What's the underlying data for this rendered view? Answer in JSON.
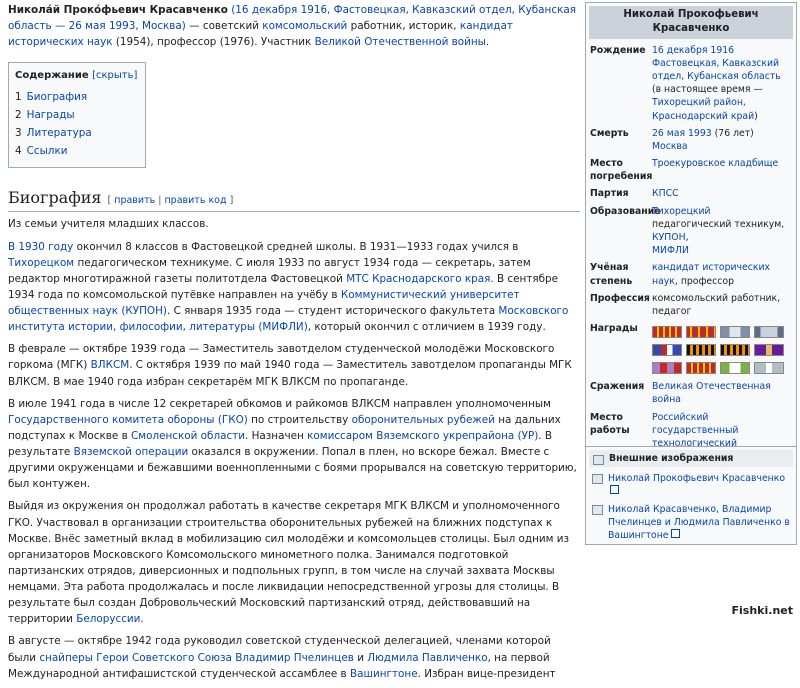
{
  "intro": {
    "name": "Никола́й Проко́фьевич Красавченко",
    "dates_link": "(16 декабря 1916, Фастовецкая, Кавказский отдел, Кубанская область — 26 мая 1993, Москва)",
    "t1": " — советский ",
    "l1": "комсомольский",
    "t2": " работник, историк, ",
    "l2": "кандидат исторических наук",
    "t3": " (1954), профессор (1976). Участник ",
    "l3": "Великой Отечественной войны",
    "t4": "."
  },
  "toc": {
    "title": "Содержание",
    "hide": "[скрыть]",
    "items": [
      {
        "num": "1",
        "label": "Биография"
      },
      {
        "num": "2",
        "label": "Награды"
      },
      {
        "num": "3",
        "label": "Литература"
      },
      {
        "num": "4",
        "label": "Ссылки"
      }
    ]
  },
  "section": {
    "heading": "Биография",
    "edit_open": "[ ",
    "edit": "править",
    "edit_sep": " | ",
    "edit_code": "править код",
    "edit_close": " ]"
  },
  "p1": {
    "t1": "Из семьи учителя младших классов."
  },
  "p2": {
    "l1": "В 1930 году",
    "t1": " окончил 8 классов в Фастовецкой средней школы. В 1931—1933 годах учился в ",
    "l2": "Тихорецком",
    "t2": " педагогическом техникуме. С июля 1933 по август 1934 года — секретарь, затем редактор многотиражной газеты политотдела Фастовецкой ",
    "l3": "МТС",
    "t3": " ",
    "l4": "Краснодарского края",
    "t4": ". В сентябре 1934 года по комсомольской путёвке направлен на учёбу в ",
    "l5": "Коммунистический университет общественных наук (КУПОН)",
    "t5": ". С января 1935 года — студент исторического факультета ",
    "l6": "Московского института истории, философии, литературы (МИФЛИ)",
    "t6": ", который окончил с отличием в 1939 году."
  },
  "p3": {
    "t1": "В феврале — октябре 1939 года — Заместитель завотделом студенческой молодёжи Московского горкома (МГК) ",
    "l1": "ВЛКСМ",
    "t2": ". С октября 1939 по май 1940 года — Заместитель завотделом пропаганды МГК ВЛКСМ. В мае 1940 года избран секретарём МГК ВЛКСМ по пропаганде."
  },
  "p4": {
    "t1": "В июле 1941 года в числе 12 секретарей обкомов и райкомов ВЛКСМ направлен уполномоченным ",
    "l1": "Государственного комитета обороны (ГКО)",
    "t2": " по строительству ",
    "l2": "оборонительных рубежей",
    "t3": " на дальних подступах к Москве в ",
    "l3": "Смоленской области",
    "t4": ". Назначен ",
    "l4": "комиссаром",
    "t5": " ",
    "l5": "Вяземского укрепрайона (УР)",
    "t6": ". В результате ",
    "l6": "Вяземской операции",
    "t7": " оказался в окружении. Попал в плен, но вскоре бежал. Вместе с другими окруженцами и бежавшими военнопленными с боями прорывался на советскую территорию, был контужен."
  },
  "p5": {
    "t1": "Выйдя из окружения он продолжал работать в качестве секретаря МГК ВЛКСМ и уполномоченного ГКО. Участвовал в организации строительства оборонительных рубежей на ближних подступах к Москве. Внёс заметный вклад в мобилизацию сил молодёжи и комсомольцев столицы. Был одним из организаторов Московского Комсомольского минометного полка. Занимался подготовкой партизанских отрядов, диверсионных и подпольных групп, в том числе на случай захвата Москвы немцами. Эта работа продолжалась и после ликвидации непосредственной угрозы для столицы. В результате был создан Добровольческий Московский партизанский отряд, действовавший на территории ",
    "l1": "Белоруссии",
    "t2": "."
  },
  "p6": {
    "t1": "В августе — октябре 1942 года руководил советской студенческой делегацией, членами которой были ",
    "l1": "снайперы",
    "t2": " ",
    "l2": "Герои Советского Союза",
    "t3": " ",
    "l3": "Владимир Пчелинцев",
    "t4": " и ",
    "l4": "Людмила Павличенко",
    "t5": ", на первой Международной антифашистской студенческой ассамблее в ",
    "l5": "Вашингтоне",
    "t6": ". Избран вице-президент"
  },
  "infobox": {
    "title": "Николай Прокофьевич Красавченко",
    "birth_label": "Рождение",
    "birth_l1": "16 декабря 1916",
    "birth_l2": "Фастовецкая, Кавказский отдел, Кубанская область",
    "birth_t1": " (в настоящее время — ",
    "birth_l3": "Тихорецкий район, Краснодарский край",
    "birth_t2": ")",
    "death_label": "Смерть",
    "death_l1": "26 мая 1993",
    "death_t1": " (76 лет)",
    "death_l2": "Москва",
    "burial_label": "Место погребения",
    "burial_l1": "Троекуровское кладбище",
    "party_label": "Партия",
    "party_l1": "КПСС",
    "edu_label": "Образование",
    "edu_l1": "Тихорецкий",
    "edu_t1": " педагогический техникум,",
    "edu_l2": "КУПОН",
    "edu_t2": ",",
    "edu_l3": "МИФЛИ",
    "degree_label": "Учёная степень",
    "degree_l1": "кандидат исторических наук",
    "degree_t1": ", профессор",
    "prof_label": "Профессия",
    "prof_t1": "комсомольский работник, педагог",
    "awards_label": "Награды",
    "battles_label": "Сражения",
    "battles_l1": "Великая Отечественная война",
    "work_label": "Место работы",
    "work_l1": "Российский государственный технологический университет имени К. Э. Циолковского"
  },
  "ribbons": [
    "repeating-linear-gradient(90deg,#c62828 0 4px,#f9c800 4px 6px)",
    "repeating-linear-gradient(90deg,#c62828 0 3px,#f9c800 3px 5px,#c62828 5px 8px)",
    "linear-gradient(90deg,#7f8fa8 0 30%,#dfe6ee 30% 70%,#7f8fa8 70%)",
    "linear-gradient(90deg,#5d6e8a 0 20%,#c8d2dc 20% 80%,#5d6e8a 80%)",
    "linear-gradient(90deg,#3949ab 0 30%,#c62828 30% 50%,#fff 50% 70%,#3949ab 70%)",
    "repeating-linear-gradient(90deg,#111 0 3px,#f58f00 3px 6px)",
    "repeating-linear-gradient(90deg,#111 0 3px,#f58f00 3px 6px)",
    "linear-gradient(90deg,#6a1b9a 0 40%,#e0c060 40% 60%,#6a1b9a 60%)",
    "linear-gradient(90deg,#ad7fc2 0 25%,#c62828 25% 50%,#ad7fc2 50% 75%,#c62828 75%)",
    "repeating-linear-gradient(90deg,#c62828 0 4px,#f9c800 4px 6px)",
    "linear-gradient(90deg,#7cb342 0 30%,#fff 30% 70%,#7cb342 70%)",
    "linear-gradient(90deg,#b0bec5 0 40%,#fff 40% 60%,#b0bec5 60%)"
  ],
  "ext": {
    "title": "Внешние изображения",
    "item1": "Николай Прокофьевич Красавченко",
    "item2": "Николай Красавченко, Владимир Пчелинцев и Людмила Павличенко в Вашингтоне"
  },
  "watermark": "Fishki.net"
}
